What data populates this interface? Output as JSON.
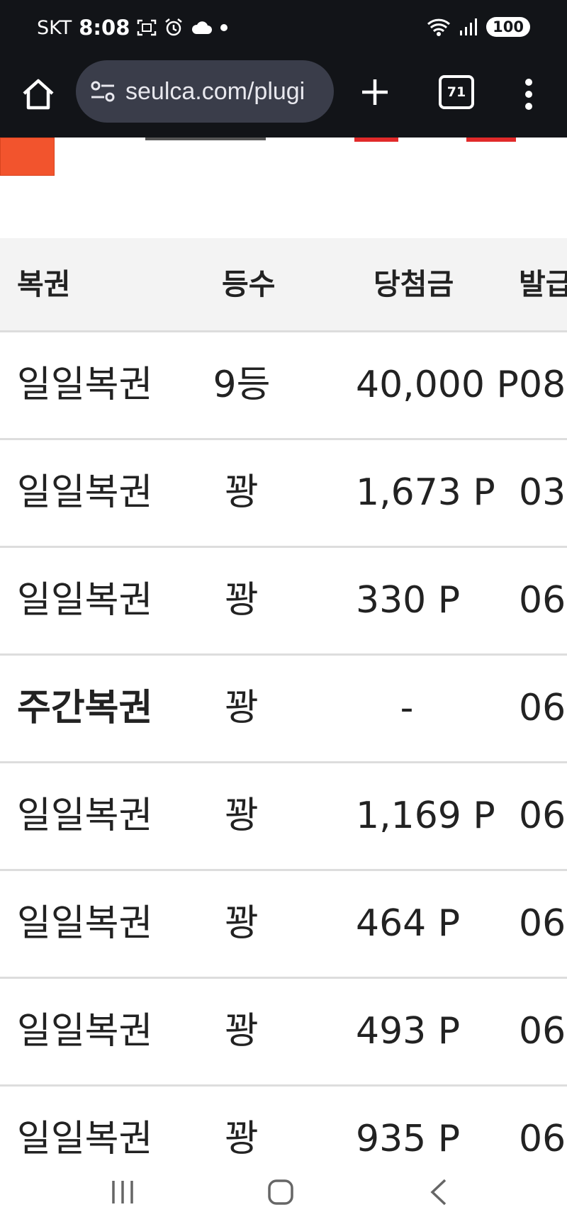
{
  "status_bar": {
    "carrier": "SKT",
    "time": "8:08",
    "battery": "100",
    "icons": [
      "screenshot-icon",
      "alarm-icon",
      "cloud-icon",
      "dot-icon",
      "wifi-icon",
      "signal-icon"
    ]
  },
  "browser": {
    "url": "seulca.com/plugi",
    "tab_count": "71",
    "icons": [
      "home-icon",
      "site-settings-icon",
      "new-tab-icon",
      "tabs-icon",
      "more-menu-icon"
    ]
  },
  "table": {
    "headers": [
      "복권",
      "등수",
      "당첨금",
      "발급"
    ],
    "rows": [
      {
        "name": "일일복권",
        "rank": "9등",
        "prize": "40,000 P",
        "date": "08",
        "bold": false
      },
      {
        "name": "일일복권",
        "rank": "꽝",
        "prize": "1,673 P",
        "date": "03",
        "bold": false
      },
      {
        "name": "일일복권",
        "rank": "꽝",
        "prize": "330 P",
        "date": "06",
        "bold": false
      },
      {
        "name": "주간복권",
        "rank": "꽝",
        "prize": "-",
        "date": "06",
        "bold": true
      },
      {
        "name": "일일복권",
        "rank": "꽝",
        "prize": "1,169 P",
        "date": "06",
        "bold": false
      },
      {
        "name": "일일복권",
        "rank": "꽝",
        "prize": "464 P",
        "date": "06",
        "bold": false
      },
      {
        "name": "일일복권",
        "rank": "꽝",
        "prize": "493 P",
        "date": "06",
        "bold": false
      },
      {
        "name": "일일복권",
        "rank": "꽝",
        "prize": "935 P",
        "date": "06",
        "bold": false
      }
    ]
  },
  "nav_bar": {
    "icons": [
      "recent-apps-icon",
      "home-icon",
      "back-icon"
    ]
  },
  "colors": {
    "toolbar_bg": "#121418",
    "url_bg": "#3a3d4a",
    "accent_orange": "#f2542d",
    "header_bg": "#f3f3f3"
  }
}
